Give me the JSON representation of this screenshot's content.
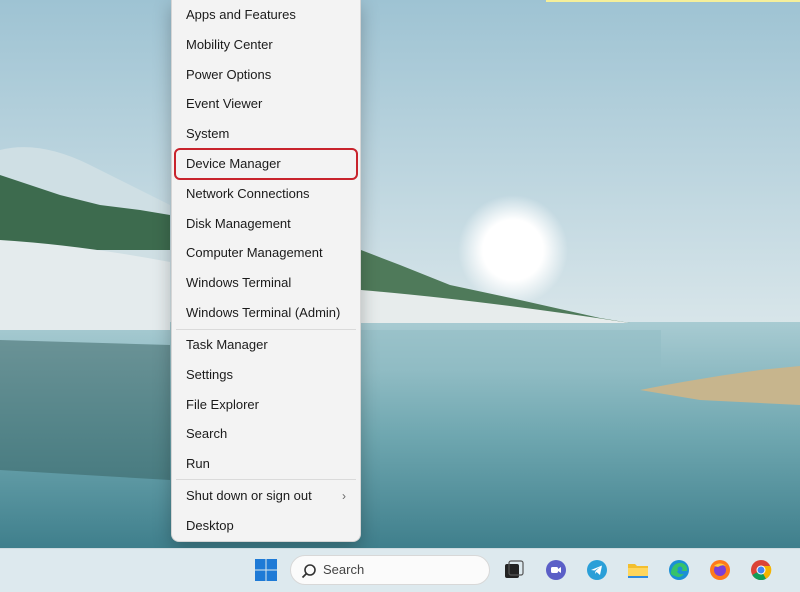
{
  "menu": {
    "group1": [
      {
        "name": "menu-item-apps-and-features",
        "label": "Apps and Features"
      },
      {
        "name": "menu-item-mobility-center",
        "label": "Mobility Center"
      },
      {
        "name": "menu-item-power-options",
        "label": "Power Options"
      },
      {
        "name": "menu-item-event-viewer",
        "label": "Event Viewer"
      },
      {
        "name": "menu-item-system",
        "label": "System"
      },
      {
        "name": "menu-item-device-manager",
        "label": "Device Manager",
        "highlighted": true
      },
      {
        "name": "menu-item-network-connections",
        "label": "Network Connections"
      },
      {
        "name": "menu-item-disk-management",
        "label": "Disk Management"
      },
      {
        "name": "menu-item-computer-management",
        "label": "Computer Management"
      },
      {
        "name": "menu-item-windows-terminal",
        "label": "Windows Terminal"
      },
      {
        "name": "menu-item-windows-terminal-admin",
        "label": "Windows Terminal (Admin)"
      }
    ],
    "group2": [
      {
        "name": "menu-item-task-manager",
        "label": "Task Manager"
      },
      {
        "name": "menu-item-settings",
        "label": "Settings"
      },
      {
        "name": "menu-item-file-explorer",
        "label": "File Explorer"
      },
      {
        "name": "menu-item-search",
        "label": "Search"
      },
      {
        "name": "menu-item-run",
        "label": "Run"
      }
    ],
    "group3": [
      {
        "name": "menu-item-shut-down-or-sign-out",
        "label": "Shut down or sign out",
        "submenu": true
      },
      {
        "name": "menu-item-desktop",
        "label": "Desktop"
      }
    ],
    "submenu_arrow": "›",
    "highlight_color": "#c8232c"
  },
  "taskbar": {
    "search_placeholder": "Search",
    "icons": [
      "windows-start-icon",
      "search-icon",
      "task-view-icon",
      "chat-icon",
      "telegram-icon",
      "file-explorer-icon",
      "edge-icon",
      "firefox-icon",
      "chrome-icon"
    ]
  }
}
